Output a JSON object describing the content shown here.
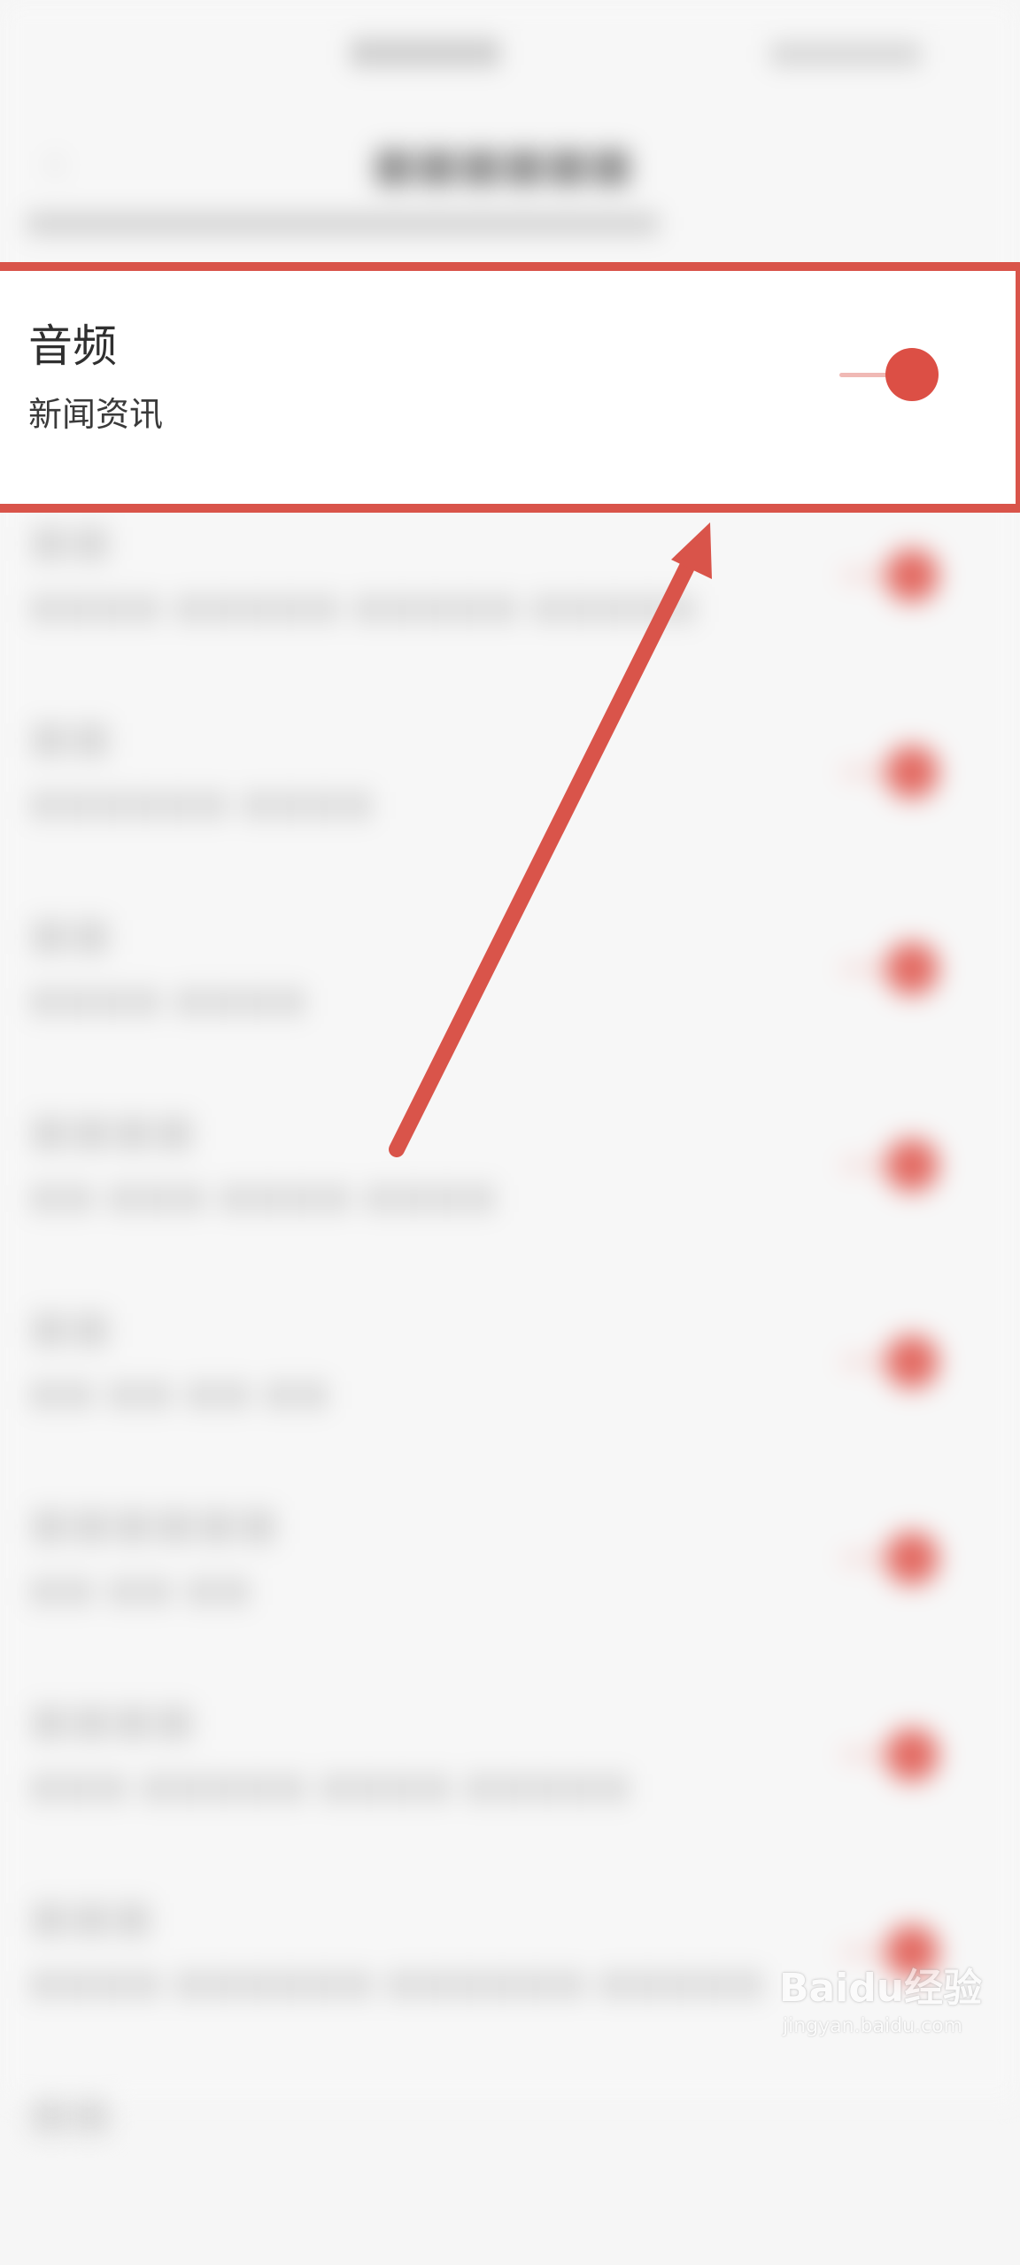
{
  "highlighted_item": {
    "title": "音频",
    "subtitle": "新闻资讯",
    "enabled": true
  },
  "colors": {
    "annotation": "#d9544a",
    "toggle_on": "#dc4f45"
  },
  "watermark": {
    "brand": "Baidu经验",
    "sub": "jingyan.baidu.com"
  }
}
